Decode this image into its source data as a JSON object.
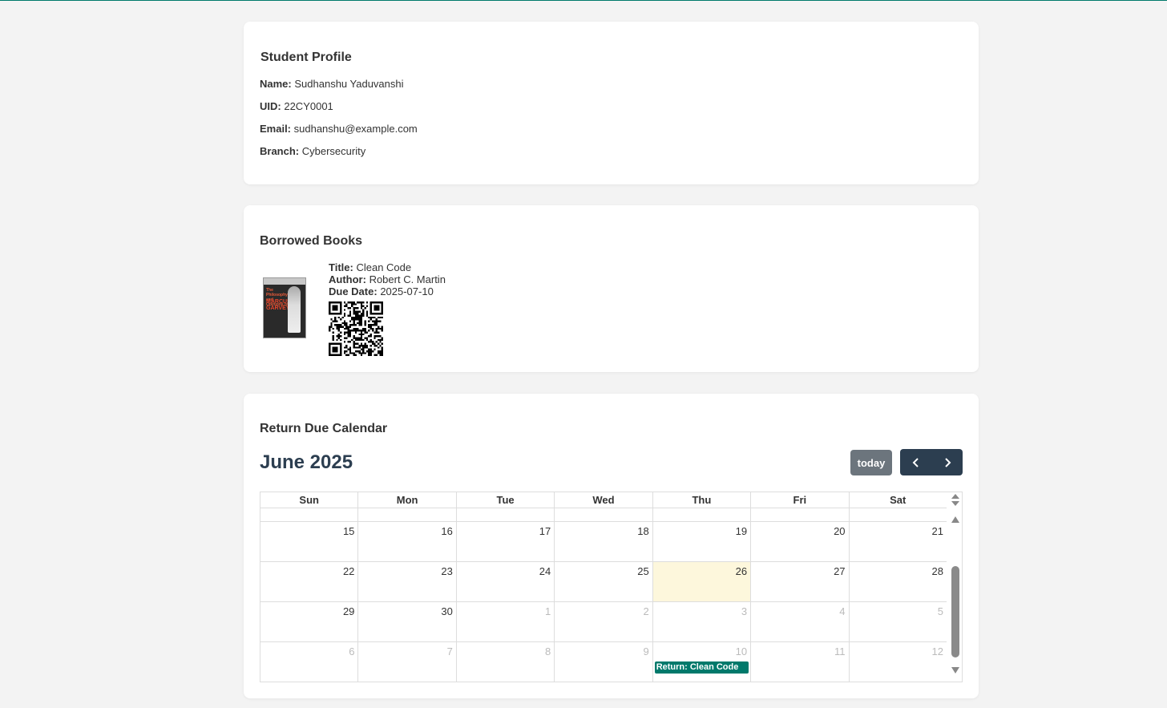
{
  "profile": {
    "title": "Student Profile",
    "fields": [
      {
        "label": "Name:",
        "value": "Sudhanshu Yaduvanshi"
      },
      {
        "label": "UID:",
        "value": "22CY0001"
      },
      {
        "label": "Email:",
        "value": "sudhanshu@example.com"
      },
      {
        "label": "Branch:",
        "value": "Cybersecurity"
      }
    ]
  },
  "books": {
    "title": "Borrowed Books",
    "items": [
      {
        "title_label": "Title:",
        "title": "Clean Code",
        "author_label": "Author:",
        "author": "Robert C. Martin",
        "due_label": "Due Date:",
        "due": "2025-07-10",
        "cover_icon": "book-cover-image",
        "cover_text": "The Philosophy and Opinions of",
        "cover_name": "MARCUS GARVEY"
      }
    ]
  },
  "calendar": {
    "title": "Return Due Calendar",
    "month_title": "June 2025",
    "today_label": "today",
    "prev_icon": "chevron-left-icon",
    "next_icon": "chevron-right-icon",
    "weekdays": [
      "Sun",
      "Mon",
      "Tue",
      "Wed",
      "Thu",
      "Fri",
      "Sat"
    ],
    "weeks": [
      [
        {
          "d": "15"
        },
        {
          "d": "16"
        },
        {
          "d": "17"
        },
        {
          "d": "18"
        },
        {
          "d": "19"
        },
        {
          "d": "20"
        },
        {
          "d": "21"
        }
      ],
      [
        {
          "d": "22"
        },
        {
          "d": "23"
        },
        {
          "d": "24"
        },
        {
          "d": "25"
        },
        {
          "d": "26",
          "today": true
        },
        {
          "d": "27"
        },
        {
          "d": "28"
        }
      ],
      [
        {
          "d": "29"
        },
        {
          "d": "30"
        },
        {
          "d": "1",
          "other": true
        },
        {
          "d": "2",
          "other": true
        },
        {
          "d": "3",
          "other": true
        },
        {
          "d": "4",
          "other": true
        },
        {
          "d": "5",
          "other": true
        }
      ],
      [
        {
          "d": "6",
          "other": true
        },
        {
          "d": "7",
          "other": true
        },
        {
          "d": "8",
          "other": true
        },
        {
          "d": "9",
          "other": true
        },
        {
          "d": "10",
          "other": true,
          "event": "Return: Clean Code"
        },
        {
          "d": "11",
          "other": true
        },
        {
          "d": "12",
          "other": true
        }
      ]
    ],
    "colors": {
      "event": "#00796b",
      "today_bg": "#fdf7dc",
      "nav": "#2c3e50",
      "today_btn": "#6c757d"
    }
  }
}
